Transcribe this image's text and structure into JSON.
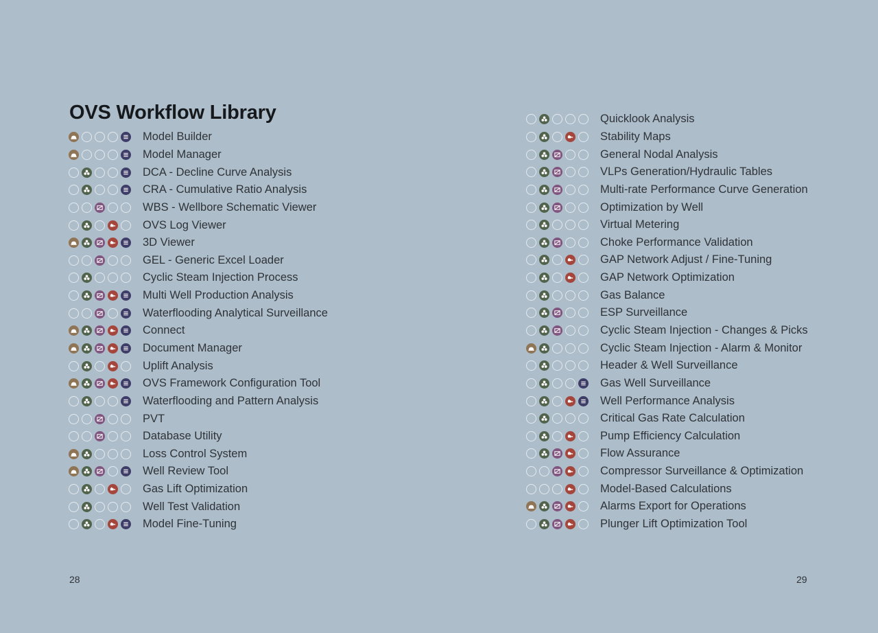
{
  "title": "OVS Workflow Library",
  "page_left": "28",
  "page_right": "29",
  "categories": [
    {
      "icon": "facility-icon",
      "color": "#8f7556"
    },
    {
      "icon": "reservoir-icon",
      "color": "#52634c"
    },
    {
      "icon": "well-icon",
      "color": "#80557f"
    },
    {
      "icon": "pump-icon",
      "color": "#a5463d"
    },
    {
      "icon": "data-icon",
      "color": "#3e3d68"
    }
  ],
  "left": [
    {
      "label": "Model Builder",
      "flags": [
        1,
        0,
        0,
        0,
        1
      ]
    },
    {
      "label": "Model Manager",
      "flags": [
        1,
        0,
        0,
        0,
        1
      ]
    },
    {
      "label": "DCA - Decline Curve Analysis",
      "flags": [
        0,
        1,
        0,
        0,
        1
      ]
    },
    {
      "label": "CRA - Cumulative Ratio Analysis",
      "flags": [
        0,
        1,
        0,
        0,
        1
      ]
    },
    {
      "label": "WBS - Wellbore Schematic Viewer",
      "flags": [
        0,
        0,
        1,
        0,
        0
      ]
    },
    {
      "label": "OVS Log Viewer",
      "flags": [
        0,
        1,
        0,
        1,
        0
      ]
    },
    {
      "label": "3D Viewer",
      "flags": [
        1,
        1,
        1,
        1,
        1
      ]
    },
    {
      "label": "GEL - Generic Excel Loader",
      "flags": [
        0,
        0,
        1,
        0,
        0
      ]
    },
    {
      "label": "Cyclic Steam Injection Process",
      "flags": [
        0,
        1,
        0,
        0,
        0
      ]
    },
    {
      "label": "Multi Well Production Analysis",
      "flags": [
        0,
        1,
        1,
        1,
        1
      ]
    },
    {
      "label": "Waterflooding Analytical Surveillance",
      "flags": [
        0,
        0,
        1,
        0,
        1
      ]
    },
    {
      "label": "Connect",
      "flags": [
        1,
        1,
        1,
        1,
        1
      ]
    },
    {
      "label": "Document Manager",
      "flags": [
        1,
        1,
        1,
        1,
        1
      ]
    },
    {
      "label": "Uplift Analysis",
      "flags": [
        0,
        1,
        0,
        1,
        0
      ]
    },
    {
      "label": "OVS Framework Configuration Tool",
      "flags": [
        1,
        1,
        1,
        1,
        1
      ]
    },
    {
      "label": "Waterflooding and Pattern Analysis",
      "flags": [
        0,
        1,
        0,
        0,
        1
      ]
    },
    {
      "label": "PVT",
      "flags": [
        0,
        0,
        1,
        0,
        0
      ]
    },
    {
      "label": "Database Utility",
      "flags": [
        0,
        0,
        1,
        0,
        0
      ]
    },
    {
      "label": "Loss Control System",
      "flags": [
        1,
        1,
        0,
        0,
        0
      ]
    },
    {
      "label": "Well Review Tool",
      "flags": [
        1,
        1,
        1,
        0,
        1
      ]
    },
    {
      "label": "Gas Lift Optimization",
      "flags": [
        0,
        1,
        0,
        1,
        0
      ]
    },
    {
      "label": "Well Test Validation",
      "flags": [
        0,
        1,
        0,
        0,
        0
      ]
    },
    {
      "label": "Model Fine-Tuning",
      "flags": [
        0,
        1,
        0,
        1,
        1
      ]
    }
  ],
  "right": [
    {
      "label": "Quicklook Analysis",
      "flags": [
        0,
        1,
        0,
        0,
        0
      ]
    },
    {
      "label": "Stability Maps",
      "flags": [
        0,
        1,
        0,
        1,
        0
      ]
    },
    {
      "label": "General Nodal Analysis",
      "flags": [
        0,
        1,
        1,
        0,
        0
      ]
    },
    {
      "label": "VLPs Generation/Hydraulic Tables",
      "flags": [
        0,
        1,
        1,
        0,
        0
      ]
    },
    {
      "label": "Multi-rate Performance Curve Generation",
      "flags": [
        0,
        1,
        1,
        0,
        0
      ]
    },
    {
      "label": "Optimization by Well",
      "flags": [
        0,
        1,
        1,
        0,
        0
      ]
    },
    {
      "label": "Virtual Metering",
      "flags": [
        0,
        1,
        0,
        0,
        0
      ]
    },
    {
      "label": "Choke Performance Validation",
      "flags": [
        0,
        1,
        1,
        0,
        0
      ]
    },
    {
      "label": "GAP Network Adjust / Fine-Tuning",
      "flags": [
        0,
        1,
        0,
        1,
        0
      ]
    },
    {
      "label": "GAP Network Optimization",
      "flags": [
        0,
        1,
        0,
        1,
        0
      ]
    },
    {
      "label": "Gas Balance",
      "flags": [
        0,
        1,
        0,
        0,
        0
      ]
    },
    {
      "label": "ESP Surveillance",
      "flags": [
        0,
        1,
        1,
        0,
        0
      ]
    },
    {
      "label": "Cyclic Steam Injection - Changes & Picks",
      "flags": [
        0,
        1,
        1,
        0,
        0
      ]
    },
    {
      "label": "Cyclic Steam Injection - Alarm & Monitor",
      "flags": [
        1,
        1,
        0,
        0,
        0
      ]
    },
    {
      "label": "Header & Well Surveillance",
      "flags": [
        0,
        1,
        0,
        0,
        0
      ]
    },
    {
      "label": "Gas Well Surveillance",
      "flags": [
        0,
        1,
        0,
        0,
        1
      ]
    },
    {
      "label": "Well Performance Analysis",
      "flags": [
        0,
        1,
        0,
        1,
        1
      ]
    },
    {
      "label": "Critical Gas Rate Calculation",
      "flags": [
        0,
        1,
        0,
        0,
        0
      ]
    },
    {
      "label": "Pump Efficiency Calculation",
      "flags": [
        0,
        1,
        0,
        1,
        0
      ]
    },
    {
      "label": "Flow Assurance",
      "flags": [
        0,
        1,
        1,
        1,
        0
      ]
    },
    {
      "label": "Compressor Surveillance & Optimization",
      "flags": [
        0,
        0,
        1,
        1,
        0
      ]
    },
    {
      "label": "Model-Based Calculations",
      "flags": [
        0,
        0,
        0,
        1,
        0
      ]
    },
    {
      "label": "Alarms Export for Operations",
      "flags": [
        1,
        1,
        1,
        1,
        0
      ]
    },
    {
      "label": "Plunger Lift Optimization Tool",
      "flags": [
        0,
        1,
        1,
        1,
        0
      ]
    }
  ]
}
